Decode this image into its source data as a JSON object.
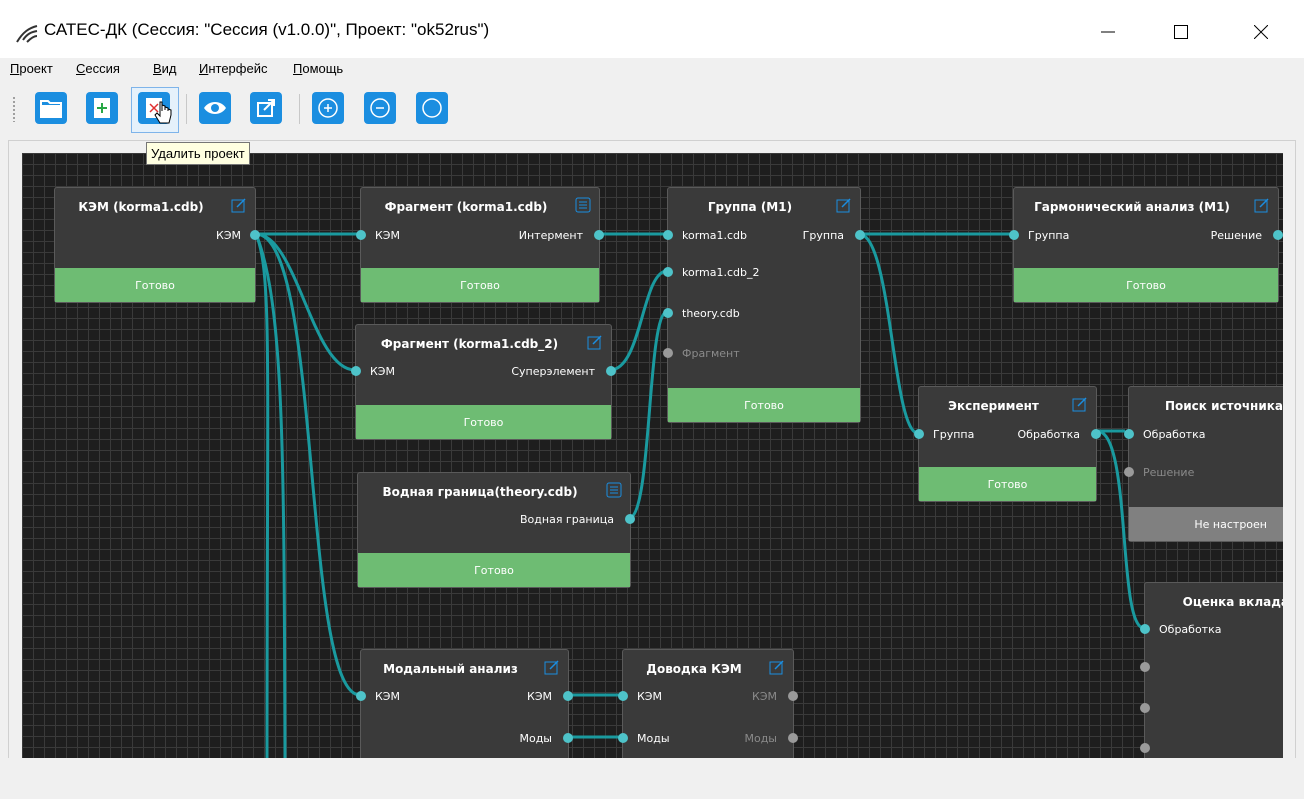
{
  "window": {
    "title": "САТЕС-ДК (Сессия: \"Сессия (v1.0.0)\", Проект: \"ok52rus\")",
    "icon": "app-logo-icon"
  },
  "menu": [
    {
      "label": "Проект",
      "acc": "П",
      "rest": "роект"
    },
    {
      "label": "Сессия",
      "acc": "С",
      "rest": "ессия"
    },
    {
      "label": "Вид",
      "acc": "В",
      "rest": "ид"
    },
    {
      "label": "Интерфейс",
      "acc": "И",
      "rest": "нтерфейс"
    },
    {
      "label": "Помощь",
      "acc": "П",
      "rest": "омощь"
    }
  ],
  "toolbar": {
    "buttons": [
      "open-folder-icon",
      "new-project-icon",
      "delete-project-icon",
      "view-eye-icon",
      "export-icon",
      "zoom-in-icon",
      "zoom-out-icon",
      "zoom-reset-icon"
    ],
    "tooltip": "Удалить проект"
  },
  "nodes": {
    "kem": {
      "title": "КЭМ (korma1.cdb)",
      "out": "КЭМ",
      "status": "Готово"
    },
    "frag1": {
      "title": "Фрагмент (korma1.cdb)",
      "in": "КЭМ",
      "out": "Интермент",
      "status": "Готово"
    },
    "frag2": {
      "title": "Фрагмент (korma1.cdb_2)",
      "in": "КЭМ",
      "out": "Суперэлемент",
      "status": "Готово"
    },
    "water": {
      "title": "Водная граница(theory.cdb)",
      "out": "Водная граница",
      "status": "Готово"
    },
    "group": {
      "title": "Группа (М1)",
      "in1": "korma1.cdb",
      "in2": "korma1.cdb_2",
      "in3": "theory.cdb",
      "in4": "Фрагмент",
      "out": "Группа",
      "status": "Готово"
    },
    "harm": {
      "title": "Гармонический анализ (М1)",
      "in": "Группа",
      "out": "Решение",
      "status": "Готово"
    },
    "exp": {
      "title": "Эксперимент",
      "in": "Группа",
      "out": "Обработка",
      "status": "Готово"
    },
    "search": {
      "title": "Поиск источника",
      "in1": "Обработка",
      "in2": "Решение",
      "status": "Не настроен"
    },
    "contrib": {
      "title": "Оценка вклада",
      "in": "Обработка"
    },
    "modal": {
      "title": "Модальный анализ",
      "in": "КЭМ",
      "out1": "КЭМ",
      "out2": "Моды"
    },
    "tune": {
      "title": "Доводка КЭМ",
      "in1": "КЭМ",
      "in2": "Моды",
      "out1": "КЭМ",
      "out2": "Моды"
    }
  },
  "colors": {
    "link": "#1a9a9f",
    "port": "#4ec3c9",
    "ready": "#6ebc73",
    "not_configured": "#808080",
    "node_bg": "#3a3a3a",
    "accent": "#1b8ee0"
  }
}
